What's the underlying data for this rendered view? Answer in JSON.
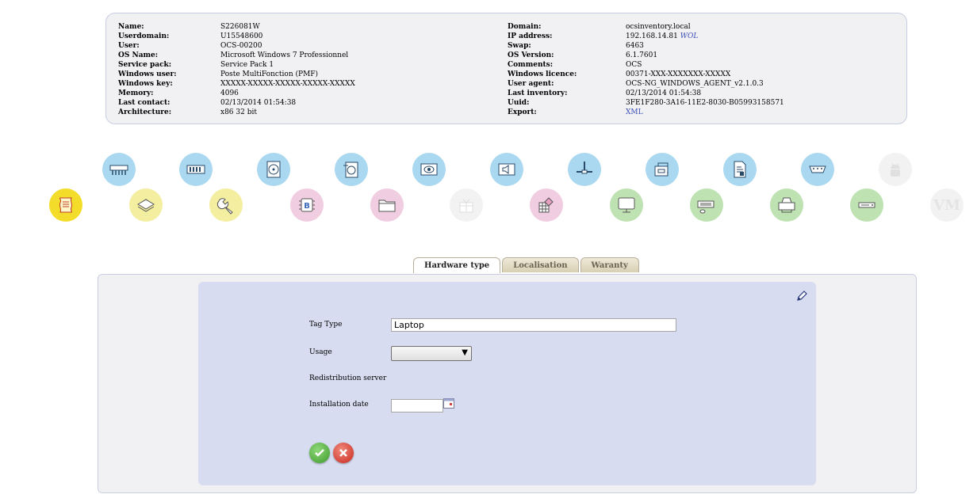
{
  "summary": {
    "left": [
      {
        "label": "Name:",
        "value": "S226081W"
      },
      {
        "label": "Userdomain:",
        "value": "U15548600"
      },
      {
        "label": "User:",
        "value": "OCS-00200"
      },
      {
        "label": "OS Name:",
        "value": "Microsoft Windows 7 Professionnel"
      },
      {
        "label": "Service pack:",
        "value": "Service Pack 1"
      },
      {
        "label": "Windows user:",
        "value": "Poste MultiFonction (PMF)"
      },
      {
        "label": "Windows key:",
        "value": "XXXXX-XXXXX-XXXXX-XXXXX-XXXXX"
      },
      {
        "label": "Memory:",
        "value": "4096"
      },
      {
        "label": "Last contact:",
        "value": "02/13/2014 01:54:38"
      },
      {
        "label": "Architecture:",
        "value": "x86 32 bit"
      }
    ],
    "right": [
      {
        "label": "Domain:",
        "value": "ocsinventory.local"
      },
      {
        "label": "IP address:",
        "value": "192.168.14.81",
        "link": "WOL"
      },
      {
        "label": "Swap:",
        "value": "6463"
      },
      {
        "label": "OS Version:",
        "value": "6.1.7601"
      },
      {
        "label": "Comments:",
        "value": "OCS"
      },
      {
        "label": "Windows licence:",
        "value": "00371-XXX-XXXXXXX-XXXXX"
      },
      {
        "label": "User agent:",
        "value": "OCS-NG_WINDOWS_AGENT_v2.1.0.3"
      },
      {
        "label": "Last inventory:",
        "value": "02/13/2014 01:54:38"
      },
      {
        "label": "Uuid:",
        "value": "3FE1F280-3A16-11E2-8030-B05993158571"
      },
      {
        "label": "Export:",
        "value": "",
        "link": "XML"
      }
    ]
  },
  "icons": {
    "vm_text": "VM",
    "bios_letter": "B"
  },
  "tabs": [
    "Hardware type",
    "Localisation",
    "Waranty"
  ],
  "form": {
    "tag_type_label": "Tag Type",
    "tag_type_value": "Laptop",
    "usage_label": "Usage",
    "usage_value": "",
    "redistribution_label": "Redistribution server",
    "install_date_label": "Installation date",
    "install_date_value": ""
  },
  "colors": {
    "accent_link": "#3a4fb8",
    "form_bg": "#d7dcf1",
    "ok_green": "#3d9a2b",
    "cancel_red": "#c9261b"
  }
}
